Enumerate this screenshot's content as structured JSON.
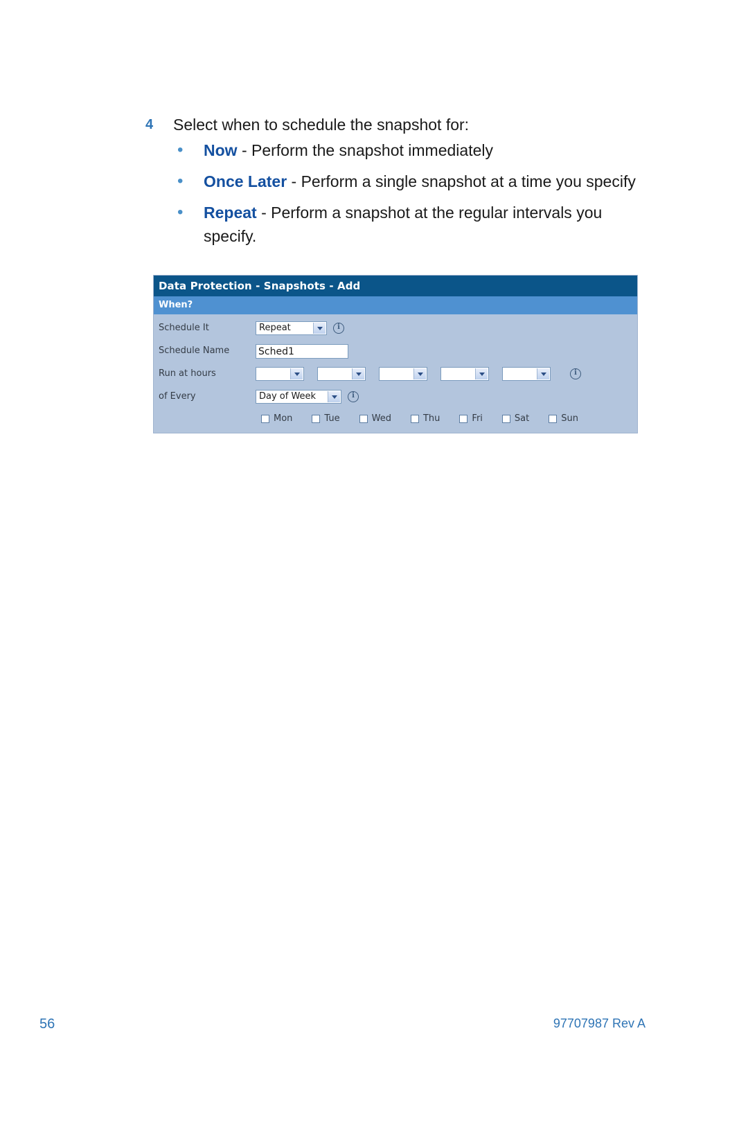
{
  "page": {
    "step_number": "4",
    "step_text": "Select when to schedule the snapshot for:",
    "bullets": [
      {
        "keyword": "Now",
        "rest": " - Perform the snapshot immediately"
      },
      {
        "keyword": "Once Later",
        "rest": " - Perform a single snapshot at a time you specify"
      },
      {
        "keyword": "Repeat",
        "rest": " - Perform a snapshot at the regular intervals you specify."
      }
    ],
    "footer": {
      "page_number": "56",
      "doc_id": "97707987 Rev A"
    },
    "colors": {
      "keyword_blue": "#1450a0",
      "step_number_blue": "#2e74b5",
      "bullet_dot_blue": "#4a90c8",
      "footer_blue": "#2e74b5"
    }
  },
  "screenshot": {
    "title": "Data Protection - Snapshots - Add",
    "section": "When?",
    "colors": {
      "titlebar": "#0b5589",
      "section_bar": "#4f91d1",
      "body": "#b3c5dd"
    },
    "fields": {
      "schedule_it": {
        "label": "Schedule It",
        "value": "Repeat",
        "info_icon": "info-icon"
      },
      "schedule_name": {
        "label": "Schedule Name",
        "value": "Sched1"
      },
      "run_at_hours": {
        "label": "Run at hours",
        "values": [
          "",
          "",
          "",
          "",
          ""
        ],
        "info_icon": "info-icon"
      },
      "of_every": {
        "label": "of Every",
        "value": "Day of Week",
        "info_icon": "info-icon"
      }
    },
    "days": [
      {
        "label": "Mon",
        "checked": false
      },
      {
        "label": "Tue",
        "checked": false
      },
      {
        "label": "Wed",
        "checked": false
      },
      {
        "label": "Thu",
        "checked": false
      },
      {
        "label": "Fri",
        "checked": false
      },
      {
        "label": "Sat",
        "checked": false
      },
      {
        "label": "Sun",
        "checked": false
      }
    ]
  }
}
